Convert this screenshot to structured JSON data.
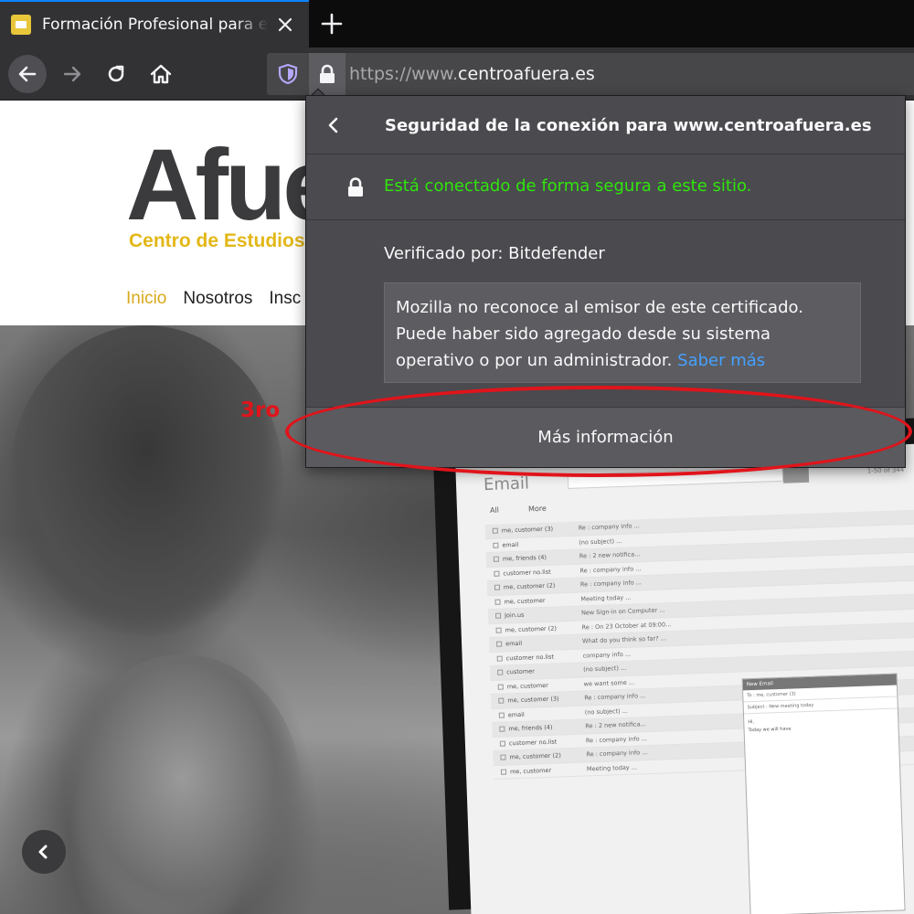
{
  "browser": {
    "tab": {
      "title": "Formación Profesional para el E",
      "favicon_color": "#e8c63a"
    },
    "new_tab_label": "+",
    "url": {
      "scheme_prefix": "https://www.",
      "domain": "centroafuera.es"
    },
    "accent_color": "#0a84ff"
  },
  "page": {
    "logo_text": "Afue",
    "logo_subtext": "Centro de Estudios",
    "logo_color": "#3b3b3d",
    "logo_sub_color": "#e3b717",
    "nav": [
      {
        "label": "Inicio",
        "active": true
      },
      {
        "label": "Nosotros",
        "active": false
      },
      {
        "label": "Insc",
        "active": false
      }
    ],
    "laptop_screen": {
      "app_title": "Email",
      "count_text": "1-50 of 344",
      "tabs": [
        "All",
        "More"
      ],
      "rows": [
        {
          "from": "me, customer (3)",
          "subject": "Re : company info ..."
        },
        {
          "from": "email",
          "subject": "(no subject) ..."
        },
        {
          "from": "me, friends (4)",
          "subject": "Re : 2 new notifica..."
        },
        {
          "from": "customer no.list",
          "subject": "Re : company info ..."
        },
        {
          "from": "me, customer (2)",
          "subject": "Re : company info ..."
        },
        {
          "from": "me, customer",
          "subject": "Meeting today ..."
        },
        {
          "from": "Join.us",
          "subject": "New Sign-in on Computer ..."
        },
        {
          "from": "me, customer (2)",
          "subject": "Re : On 23 October at 09:00..."
        },
        {
          "from": "email",
          "subject": "What do you think so far? ..."
        },
        {
          "from": "customer no.list",
          "subject": "company info ..."
        },
        {
          "from": "customer",
          "subject": "(no subject) ..."
        },
        {
          "from": "me, customer",
          "subject": "we want some ..."
        },
        {
          "from": "me, customer (3)",
          "subject": "Re : company info ..."
        },
        {
          "from": "email",
          "subject": "(no subject) ..."
        },
        {
          "from": "me, friends (4)",
          "subject": "Re : 2 new notifica..."
        },
        {
          "from": "customer no.list",
          "subject": "Re : company info ..."
        },
        {
          "from": "me, customer (2)",
          "subject": "Re : company info ..."
        },
        {
          "from": "me, customer",
          "subject": "Meeting today ..."
        }
      ],
      "compose": {
        "header": "New Email",
        "to": "To : me, customer (3)",
        "subject": "Subject : New meeting today",
        "body_greeting": "Hi,",
        "body_text": "Today we will have"
      }
    }
  },
  "identity_panel": {
    "title": "Seguridad de la conexión para www.centroafuera.es",
    "secure_message": "Está conectado de forma segura a este sitio.",
    "secure_color": "#30e60b",
    "verified_by": "Verificado por: Bitdefender",
    "warning_text": "Mozilla no reconoce al emisor de este certificado. Puede haber sido agregado desde su sistema operativo o por un administrador.",
    "learn_more": "Saber más",
    "link_color": "#45a1ff",
    "more_info_button": "Más información"
  },
  "annotation": {
    "label": "3ro",
    "color": "#e0141b"
  }
}
